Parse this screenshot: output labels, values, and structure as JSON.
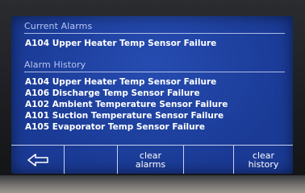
{
  "current_alarms": {
    "title": "Current Alarms",
    "items": [
      "A104 Upper Heater Temp Sensor Failure"
    ]
  },
  "alarm_history": {
    "title": "Alarm History",
    "items": [
      "A104 Upper Heater Temp Sensor Failure",
      "A106 Discharge Temp Sensor Failure",
      "A102 Ambient Temperature Sensor Failure",
      "A101 Suction Temperature Sensor Failure",
      "A105 Evaporator Temp Sensor Failure"
    ]
  },
  "buttons": {
    "back_icon": "left-arrow-icon",
    "clear_alarms_line1": "clear",
    "clear_alarms_line2": "alarms",
    "clear_history_line1": "clear",
    "clear_history_line2": "history"
  },
  "colors": {
    "screen": "#1a3a95",
    "text": "#ffffff",
    "section_title": "#b9c6ee",
    "rule": "#c9d2ee"
  }
}
